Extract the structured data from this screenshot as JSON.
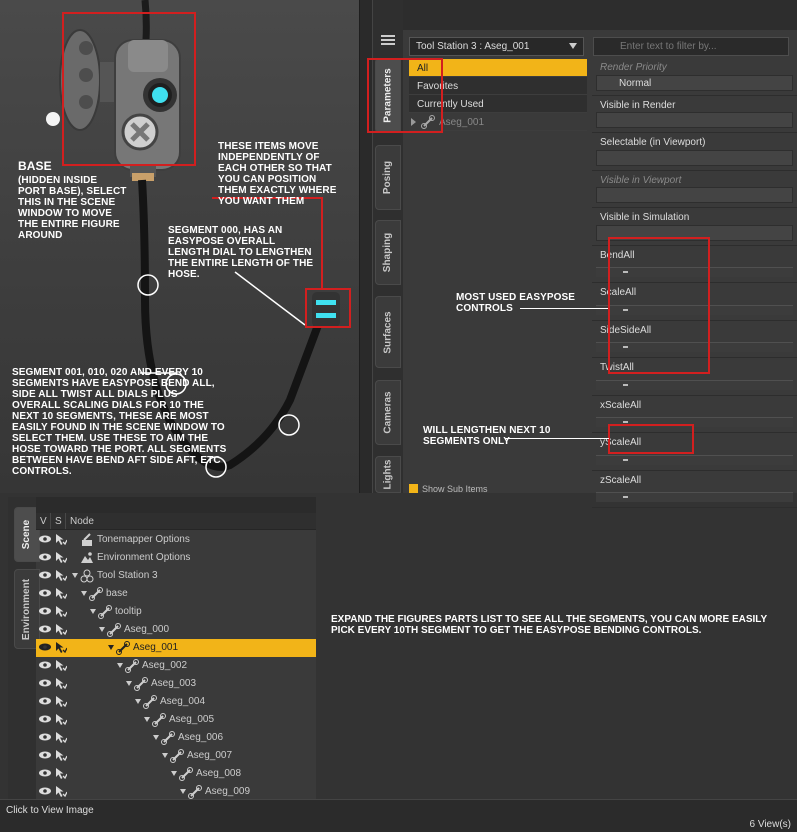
{
  "viewport": {
    "annotations": {
      "base_title": "BASE",
      "base_text": "(HIDDEN INSIDE PORT BASE), SELECT THIS IN THE SCENE WINDOW TO MOVE THE ENTIRE FIGURE AROUND",
      "independent": "THESE ITEMS MOVE INDEPENDENTLY OF EACH OTHER SO THAT YOU CAN POSITION THEM EXACTLY WHERE YOU WANT THEM",
      "segment000": "SEGMENT 000, HAS AN EASYPOSE OVERALL LENGTH DIAL TO LENGTHEN THE ENTIRE LENGTH OF THE HOSE.",
      "segment001": "SEGMENT 001, 010, 020 AND EVERY 10 SEGMENTS HAVE EASYPOSE BEND ALL, SIDE ALL TWIST ALL DIALS PLUS OVERALL SCALING DIALS FOR 10 THE NEXT 10 SEGMENTS, THESE ARE MOST EASILY FOUND IN THE SCENE WINDOW TO SELECT THEM. USE THESE TO AIM THE HOSE TOWARD THE PORT. ALL SEGMENTS BETWEEN HAVE BEND AFT SIDE AFT, ETC CONTROLS."
    }
  },
  "params": {
    "tabs": [
      "Parameters",
      "Posing",
      "Shaping",
      "Surfaces",
      "Cameras",
      "Lights"
    ],
    "figure_select": "Tool Station 3 : Aseg_001",
    "filter_placeholder": "Enter text to filter by...",
    "categories": [
      "All",
      "Favorites",
      "Currently Used"
    ],
    "node_item": "Aseg_001",
    "properties": [
      {
        "label": "Render Priority",
        "value": "Normal",
        "dim": true,
        "kind": "value"
      },
      {
        "label": "Visible in Render",
        "value": "",
        "dim": false,
        "kind": "value"
      },
      {
        "label": "Selectable (in Viewport)",
        "value": "",
        "dim": false,
        "kind": "value"
      },
      {
        "label": "Visible in Viewport",
        "value": "",
        "dim": true,
        "kind": "value"
      },
      {
        "label": "Visible in Simulation",
        "value": "",
        "dim": false,
        "kind": "value"
      },
      {
        "label": "BendAll",
        "value": "",
        "dim": false,
        "kind": "slider"
      },
      {
        "label": "ScaleAll",
        "value": "",
        "dim": false,
        "kind": "slider"
      },
      {
        "label": "SideSideAll",
        "value": "",
        "dim": false,
        "kind": "slider"
      },
      {
        "label": "TwistAll",
        "value": "",
        "dim": false,
        "kind": "slider"
      },
      {
        "label": "xScaleAll",
        "value": "",
        "dim": false,
        "kind": "slider"
      },
      {
        "label": "yScaleAll",
        "value": "",
        "dim": false,
        "kind": "slider"
      },
      {
        "label": "zScaleAll",
        "value": "",
        "dim": false,
        "kind": "slider"
      }
    ],
    "show_sub_items": "Show Sub Items",
    "annotations": {
      "most_used": "MOST USED EASYPOSE CONTROLS",
      "lengthen": "WILL LENGTHEN NEXT 10 SEGMENTS ONLY"
    }
  },
  "scene": {
    "tabs": [
      "Scene",
      "Environment"
    ],
    "columns": {
      "v": "V",
      "s": "S",
      "node": "Node"
    },
    "rows": [
      {
        "name": "Tonemapper Options",
        "indent": 0,
        "icon": "tonemapper-icon",
        "expand": false,
        "selected": false
      },
      {
        "name": "Environment Options",
        "indent": 0,
        "icon": "environment-icon",
        "expand": false,
        "selected": false
      },
      {
        "name": "Tool Station 3",
        "indent": 0,
        "icon": "figure-icon",
        "expand": true,
        "selected": false
      },
      {
        "name": "base",
        "indent": 1,
        "icon": "bone-icon",
        "expand": true,
        "selected": false
      },
      {
        "name": "tooltip",
        "indent": 2,
        "icon": "bone-icon",
        "expand": true,
        "selected": false
      },
      {
        "name": "Aseg_000",
        "indent": 3,
        "icon": "bone-icon",
        "expand": true,
        "selected": false
      },
      {
        "name": "Aseg_001",
        "indent": 4,
        "icon": "bone-icon",
        "expand": true,
        "selected": true
      },
      {
        "name": "Aseg_002",
        "indent": 5,
        "icon": "bone-icon",
        "expand": true,
        "selected": false
      },
      {
        "name": "Aseg_003",
        "indent": 6,
        "icon": "bone-icon",
        "expand": true,
        "selected": false
      },
      {
        "name": "Aseg_004",
        "indent": 7,
        "icon": "bone-icon",
        "expand": true,
        "selected": false
      },
      {
        "name": "Aseg_005",
        "indent": 8,
        "icon": "bone-icon",
        "expand": true,
        "selected": false
      },
      {
        "name": "Aseg_006",
        "indent": 9,
        "icon": "bone-icon",
        "expand": true,
        "selected": false
      },
      {
        "name": "Aseg_007",
        "indent": 10,
        "icon": "bone-icon",
        "expand": true,
        "selected": false
      },
      {
        "name": "Aseg_008",
        "indent": 11,
        "icon": "bone-icon",
        "expand": true,
        "selected": false
      },
      {
        "name": "Aseg_009",
        "indent": 12,
        "icon": "bone-icon",
        "expand": true,
        "selected": false
      }
    ]
  },
  "expand_note": "EXPAND THE FIGURES PARTS LIST TO SEE ALL THE SEGMENTS, YOU CAN MORE EASILY PICK EVERY 10TH SEGMENT TO GET THE EASYPOSE BENDING CONTROLS.",
  "footer": {
    "click_to_view": "Click to View Image",
    "views": "6 View(s)"
  },
  "colors": {
    "selection": "#f2b418",
    "annotation_box": "#d21f1f",
    "accent_cyan": "#3fe0ef"
  }
}
